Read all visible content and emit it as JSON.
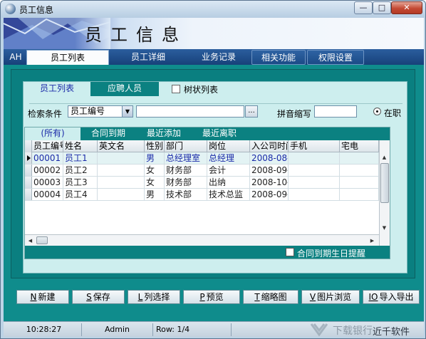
{
  "window": {
    "title": "员工信息",
    "min_label": "—",
    "max_label": "□",
    "close_label": "✕"
  },
  "banner": {
    "title": "员工信息"
  },
  "top_tabs": [
    {
      "label": "AH"
    },
    {
      "label": "员工列表"
    },
    {
      "label": "员工详细"
    },
    {
      "label": "业务记录"
    },
    {
      "label": "相关功能"
    },
    {
      "label": "权限设置"
    }
  ],
  "sub_tabs": {
    "employee_list": "员工列表",
    "applicants": "应聘人员",
    "tree_list": "树状列表"
  },
  "search": {
    "label": "检索条件",
    "field_value": "员工编号",
    "input_value": "",
    "dots": "...",
    "pinyin_label": "拼音缩写",
    "pinyin_value": "",
    "radio_label": "在职"
  },
  "grid_tabs": [
    "(所有)",
    "合同到期",
    "最近添加",
    "最近离职"
  ],
  "columns": [
    "员工编号",
    "姓名",
    "英文名",
    "性别",
    "部门",
    "岗位",
    "入公司时间",
    "手机",
    "宅电"
  ],
  "rows": [
    [
      "00001",
      "员工1",
      "",
      "男",
      "总经理室",
      "总经理",
      "2008-08-",
      "",
      ""
    ],
    [
      "00002",
      "员工2",
      "",
      "女",
      "财务部",
      "会计",
      "2008-09-",
      "",
      ""
    ],
    [
      "00003",
      "员工3",
      "",
      "女",
      "财务部",
      "出纳",
      "2008-10-",
      "",
      ""
    ],
    [
      "00004",
      "员工4",
      "",
      "男",
      "技术部",
      "技术总监",
      "2008-09-",
      "",
      ""
    ]
  ],
  "selected_row": 0,
  "remind_label": "合同到期生日提醒",
  "buttons": [
    {
      "hotkey": "N",
      "label": "新建"
    },
    {
      "hotkey": "S",
      "label": "保存"
    },
    {
      "hotkey": "L",
      "label": "列选择"
    },
    {
      "hotkey": "P",
      "label": "预览"
    },
    {
      "hotkey": "T",
      "label": "缩略图"
    },
    {
      "hotkey": "V",
      "label": "图片浏览"
    },
    {
      "hotkey": "IO",
      "label": "导入导出"
    }
  ],
  "status": {
    "time": "10:28:27",
    "user": "Admin",
    "row": "Row: 1/4",
    "company": "近千软件",
    "watermark": "下载银行"
  },
  "colors": {
    "teal": "#0f8c8c",
    "light_teal": "#cdeeee",
    "nav_blue": "#17417a",
    "selected_text": "#1a2aa8"
  }
}
